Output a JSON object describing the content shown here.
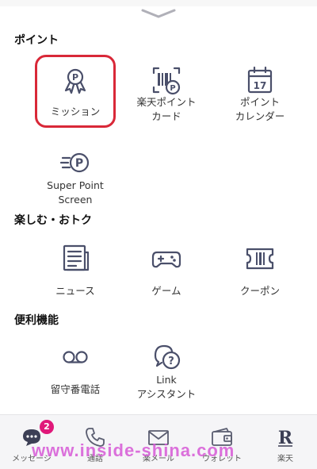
{
  "sections": {
    "point": "ポイント",
    "fun": "楽しむ・おトク",
    "tools": "便利機能"
  },
  "tiles": {
    "mission": "ミッション",
    "point_card": "楽天ポイント\nカード",
    "point_calendar": "ポイント\nカレンダー",
    "calendar_day": "17",
    "super_point": "Super Point\nScreen",
    "news": "ニュース",
    "game": "ゲーム",
    "coupon": "クーポン",
    "voicemail": "留守番電話",
    "link_assistant": "Link\nアシスタント"
  },
  "nav": {
    "message": "メッセージ",
    "message_badge": "2",
    "call": "通話",
    "mail": "楽メール",
    "wallet": "ウォレット",
    "more": "楽天"
  },
  "watermark": "www.inside-shina.com",
  "colors": {
    "icon": "#4a4f6a",
    "highlight": "#d92838",
    "badge": "#e0187a",
    "watermark": "#d658d6"
  }
}
